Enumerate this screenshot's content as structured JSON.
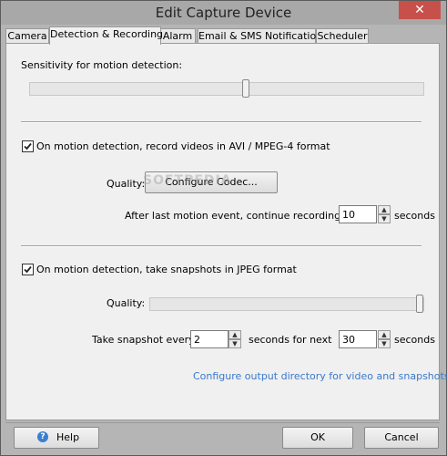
{
  "window": {
    "title": "Edit Capture Device",
    "close_glyph": "✕"
  },
  "tabs": [
    {
      "label": "Camera"
    },
    {
      "label": "Detection & Recording"
    },
    {
      "label": "Alarm"
    },
    {
      "label": "Email & SMS Notifications"
    },
    {
      "label": "Scheduler"
    }
  ],
  "motion": {
    "sensitivity_label": "Sensitivity for motion detection:",
    "sensitivity_level": 0.55
  },
  "video": {
    "checkbox_label": "On motion detection, record videos in AVI / MPEG-4 format",
    "checked": true,
    "quality_label": "Quality:",
    "codec_button": "Configure Codec...",
    "after_label": "After last motion event, continue recording for",
    "after_value": "10",
    "after_unit": "seconds"
  },
  "snapshot": {
    "checkbox_label": "On motion detection, take snapshots in JPEG format",
    "checked": true,
    "quality_label": "Quality:",
    "quality_level": 1.0,
    "every_label": "Take snapshot every",
    "every_value": "2",
    "next_label": "seconds for next",
    "next_value": "30",
    "next_unit": "seconds"
  },
  "output_link": "Configure output directory for video and snapshots...",
  "footer": {
    "help": "Help",
    "help_icon": "?",
    "ok": "OK",
    "cancel": "Cancel"
  },
  "watermark": "SOFTPEDIA"
}
